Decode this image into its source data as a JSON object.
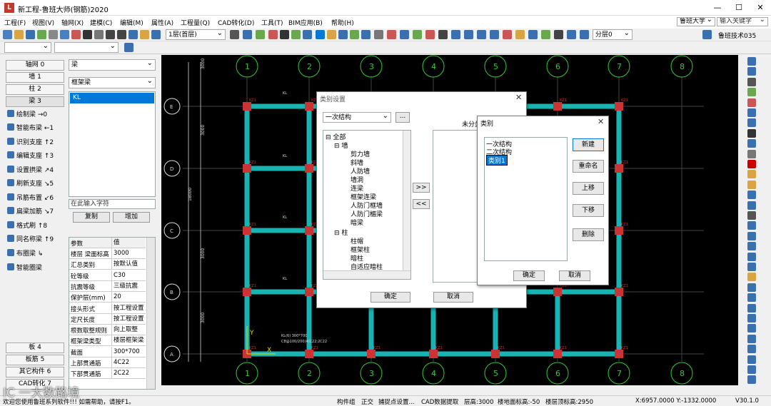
{
  "window": {
    "title": "新工程-鲁班大师(钢筋)2020"
  },
  "menu": [
    "工程(F)",
    "视图(V)",
    "轴网(X)",
    "建模(C)",
    "编辑(M)",
    "属性(A)",
    "工程量(Q)",
    "CAD转化(D)",
    "工具(T)",
    "BIM应用(B)",
    "帮助(H)"
  ],
  "search": {
    "scope": "鲁班大学",
    "placeholder": "输入关键字",
    "tech": "鲁班技术035"
  },
  "toolbar": {
    "floor": "1层(首层)",
    "layer": "分层0"
  },
  "left": {
    "categories_top": [
      "轴网 0",
      "墙 1",
      "柱 2",
      "梁 3"
    ],
    "tools": [
      "绘制梁 →0",
      "智能布梁 ←1",
      "识别支座 ↑2",
      "编辑支座 ↑3",
      "设置拱梁 ↗4",
      "刷新支座 ↘5",
      "吊筋布置 ↙6",
      "扁梁加筋 ↘7",
      "格式刷 ↑8",
      "同名称梁 ↑9",
      "布圈梁 ↳",
      "智能圈梁"
    ],
    "categories_bottom": [
      "板 4",
      "板筋 5",
      "其它构件 6",
      "CAD转化 7"
    ],
    "type_combo": "梁",
    "subtype_combo": "框架梁",
    "list_item": "KL",
    "filter_placeholder": "在此输入字符",
    "copy_btn": "复制",
    "add_btn": "增加",
    "props_header": [
      "参数",
      "值"
    ],
    "props": [
      [
        "楼层 梁面标高",
        "3000"
      ],
      [
        "汇总类别",
        "按默认值"
      ],
      [
        "砼等级",
        "C30"
      ],
      [
        "抗震等级",
        "三级抗震"
      ],
      [
        "保护层(mm)",
        "20"
      ],
      [
        "接头形式",
        "按工程设置"
      ],
      [
        "定尺长度",
        "按工程设置"
      ],
      [
        "根数取整规则",
        "向上取整"
      ],
      [
        "框架梁类型",
        "楼层框架梁"
      ],
      [
        "截面",
        "300*700"
      ],
      [
        "上部贯通筋",
        "4C22"
      ],
      [
        "下部贯通筋",
        "2C22"
      ]
    ]
  },
  "drawing": {
    "axis_top": [
      "1",
      "2",
      "3",
      "4",
      "5",
      "6",
      "7",
      "8"
    ],
    "axis_left": [
      "E",
      "D",
      "C",
      "B",
      "A"
    ],
    "dims_left": [
      "3000",
      "3000",
      "18000",
      "3000",
      "3000"
    ],
    "col_label": "KZ1",
    "beam_label": "KL",
    "annot1": "KL(6) 300*700",
    "annot2": "C8@100/200(4)C22;2C22",
    "x_label": "X",
    "y_label": "Y"
  },
  "dialog_category": {
    "title": "类别设置",
    "combo": "一次结构",
    "more_btn": "...",
    "tree": [
      "全部",
      "墙",
      "剪力墙",
      "斜墙",
      "人防墙",
      "墙洞",
      "连梁",
      "框架连梁",
      "人防门框墙",
      "人防门楣梁",
      "暗梁",
      "柱",
      "柱帽",
      "框架柱",
      "暗柱",
      "自适应暗柱"
    ],
    "move_right": ">>",
    "move_left": "<<",
    "right_header": "未分类",
    "ok": "确定",
    "cancel": "取消"
  },
  "dialog_kind": {
    "title": "类别",
    "items": [
      "一次结构",
      "二次结构",
      "类别1"
    ],
    "btn_new": "新建",
    "btn_rename": "重命名",
    "btn_up": "上移",
    "btn_down": "下移",
    "btn_delete": "删除",
    "ok": "确定",
    "cancel": "取消"
  },
  "status": {
    "welcome": "欢迎您使用鲁班系列软件!!! 如需帮助，请按F1。",
    "items": [
      "构件组",
      "正交",
      "捕捉点设置...",
      "CAD数据提取",
      "层高:3000",
      "楼地面标高:-50",
      "楼层顶标高:2950"
    ],
    "coords": "X:6957.0000 Y:-1332.0000",
    "version": "V30.1.0"
  },
  "watermark": "IC 一大数路境",
  "colors": {
    "beam": "#1ab3b3",
    "column": "#cc3333",
    "axis": "#33cc33",
    "canvas": "#000000",
    "highlight": "#0078d7"
  }
}
